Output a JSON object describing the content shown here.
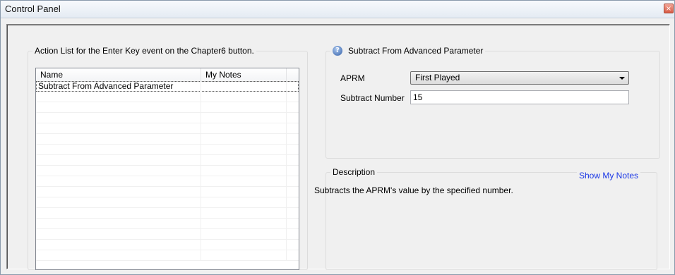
{
  "window": {
    "title": "Control Panel",
    "close_glyph": "×"
  },
  "action_list": {
    "group_title": "Action List for the Enter Key event on the Chapter6 button.",
    "columns": [
      "Name",
      "My Notes"
    ],
    "rows": [
      {
        "name": "Subtract From Advanced Parameter",
        "notes": ""
      }
    ]
  },
  "parameter": {
    "help_icon": "question-icon",
    "group_title": "Subtract From Advanced Parameter",
    "aprm_label": "APRM",
    "aprm_value": "First Played",
    "subtract_label": "Subtract Number",
    "subtract_value": "15"
  },
  "description": {
    "group_title": "Description",
    "show_notes_label": "Show My Notes",
    "text": "Subtracts the APRM's value by the specified number."
  }
}
